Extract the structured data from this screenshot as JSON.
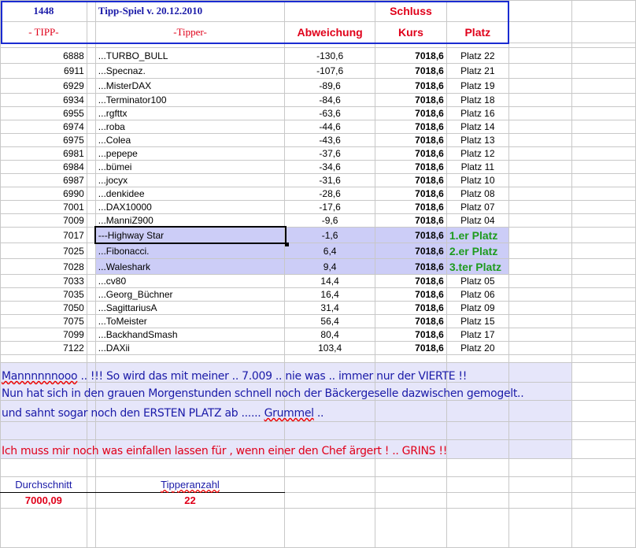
{
  "header": {
    "tipp_id": "1448",
    "title": "Tipp-Spiel v. 20.12.2010",
    "schluss": "Schluss",
    "col_tipp": "- TIPP-",
    "col_tipper": "-Tipper-",
    "col_abweichung": "Abweichung",
    "col_kurs": "Kurs",
    "col_platz": "Platz"
  },
  "rows": [
    {
      "tipp": "6888",
      "name": "...TURBO_BULL",
      "abw": "-130,6",
      "kurs": "7018,6",
      "platz": "Platz 22"
    },
    {
      "tipp": "6911",
      "name": "...Specnaz.",
      "abw": "-107,6",
      "kurs": "7018,6",
      "platz": "Platz 21"
    },
    {
      "tipp": "6929",
      "name": "...MisterDAX",
      "abw": "-89,6",
      "kurs": "7018,6",
      "platz": "Platz 19"
    },
    {
      "tipp": "6934",
      "name": "...Terminator100",
      "abw": "-84,6",
      "kurs": "7018,6",
      "platz": "Platz 18"
    },
    {
      "tipp": "6955",
      "name": "...rgfttx",
      "abw": "-63,6",
      "kurs": "7018,6",
      "platz": "Platz 16"
    },
    {
      "tipp": "6974",
      "name": "...roba",
      "abw": "-44,6",
      "kurs": "7018,6",
      "platz": "Platz 14"
    },
    {
      "tipp": "6975",
      "name": "...Colea",
      "abw": "-43,6",
      "kurs": "7018,6",
      "platz": "Platz 13"
    },
    {
      "tipp": "6981",
      "name": "...pepepe",
      "abw": "-37,6",
      "kurs": "7018,6",
      "platz": "Platz 12"
    },
    {
      "tipp": "6984",
      "name": "...bümei",
      "abw": "-34,6",
      "kurs": "7018,6",
      "platz": "Platz 11"
    },
    {
      "tipp": "6987",
      "name": "...jocyx",
      "abw": "-31,6",
      "kurs": "7018,6",
      "platz": "Platz 10"
    },
    {
      "tipp": "6990",
      "name": "...denkidee",
      "abw": "-28,6",
      "kurs": "7018,6",
      "platz": "Platz 08"
    },
    {
      "tipp": "7001",
      "name": "...DAX10000",
      "abw": "-17,6",
      "kurs": "7018,6",
      "platz": "Platz 07"
    },
    {
      "tipp": "7009",
      "name": "...ManniZ900",
      "abw": "-9,6",
      "kurs": "7018,6",
      "platz": "Platz 04"
    },
    {
      "tipp": "7017",
      "name": "---Highway Star",
      "abw": "-1,6",
      "kurs": "7018,6",
      "platz": "1.er Platz"
    },
    {
      "tipp": "7025",
      "name": "...Fibonacci.",
      "abw": "6,4",
      "kurs": "7018,6",
      "platz": "2.er Platz"
    },
    {
      "tipp": "7028",
      "name": "...Waleshark",
      "abw": "9,4",
      "kurs": "7018,6",
      "platz": "3.ter Platz"
    },
    {
      "tipp": "7033",
      "name": "...cv80",
      "abw": "14,4",
      "kurs": "7018,6",
      "platz": "Platz 05"
    },
    {
      "tipp": "7035",
      "name": "...Georg_Büchner",
      "abw": "16,4",
      "kurs": "7018,6",
      "platz": "Platz 06"
    },
    {
      "tipp": "7050",
      "name": "...SagittariusA",
      "abw": "31,4",
      "kurs": "7018,6",
      "platz": "Platz 09"
    },
    {
      "tipp": "7075",
      "name": "...ToMeister",
      "abw": "56,4",
      "kurs": "7018,6",
      "platz": "Platz 15"
    },
    {
      "tipp": "7099",
      "name": "...BackhandSmash",
      "abw": "80,4",
      "kurs": "7018,6",
      "platz": "Platz 17"
    },
    {
      "tipp": "7122",
      "name": "...DAXii",
      "abw": "103,4",
      "kurs": "7018,6",
      "platz": "Platz 20"
    }
  ],
  "messages": {
    "line1_a": "Mannnnnnooo",
    "line1_b": " .. !!!  So wird das mit meiner   ..  7.009  .. nie was .. immer nur der VIERTE !!",
    "line2": "Nun hat sich in den grauen Morgenstunden schnell noch der Bäckergeselle dazwischen gemogelt..",
    "line3_a": "und sahnt sogar noch den ERSTEN PLATZ ab ...... ",
    "line3_b": "Grummel",
    "line3_c": " ..",
    "line4": "Ich muss mir noch was einfallen lassen für , wenn einer den Chef ärgert ! .. GRINS !!"
  },
  "summary": {
    "avg_label": "Durchschnitt",
    "avg_value": "7000,09",
    "count_label": "Tipperanzahl",
    "count_value": "22"
  }
}
